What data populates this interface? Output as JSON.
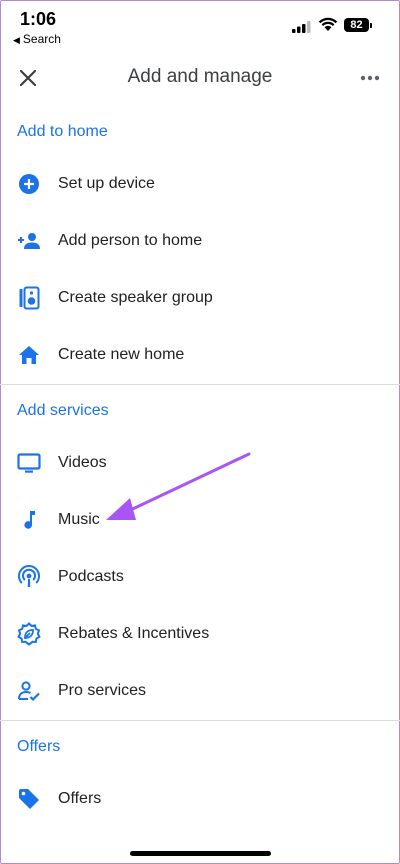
{
  "status_bar": {
    "time": "1:06",
    "back_label": "Search",
    "battery": "82"
  },
  "header": {
    "title": "Add and manage"
  },
  "sections": {
    "home": {
      "title": "Add to home",
      "items": [
        {
          "label": "Set up device",
          "icon": "add-circle-icon"
        },
        {
          "label": "Add person to home",
          "icon": "person-add-icon"
        },
        {
          "label": "Create speaker group",
          "icon": "speaker-icon"
        },
        {
          "label": "Create new home",
          "icon": "home-icon"
        }
      ]
    },
    "services": {
      "title": "Add services",
      "items": [
        {
          "label": "Videos",
          "icon": "tv-icon"
        },
        {
          "label": "Music",
          "icon": "music-note-icon"
        },
        {
          "label": "Podcasts",
          "icon": "podcast-icon"
        },
        {
          "label": "Rebates & Incentives",
          "icon": "rebates-icon"
        },
        {
          "label": "Pro services",
          "icon": "pro-services-icon"
        }
      ]
    },
    "offers": {
      "title": "Offers",
      "items": [
        {
          "label": "Offers",
          "icon": "tag-icon"
        }
      ]
    }
  },
  "colors": {
    "accent": "#1a73e8",
    "annotation_arrow": "#a855f7",
    "divider": "#dadce0"
  }
}
